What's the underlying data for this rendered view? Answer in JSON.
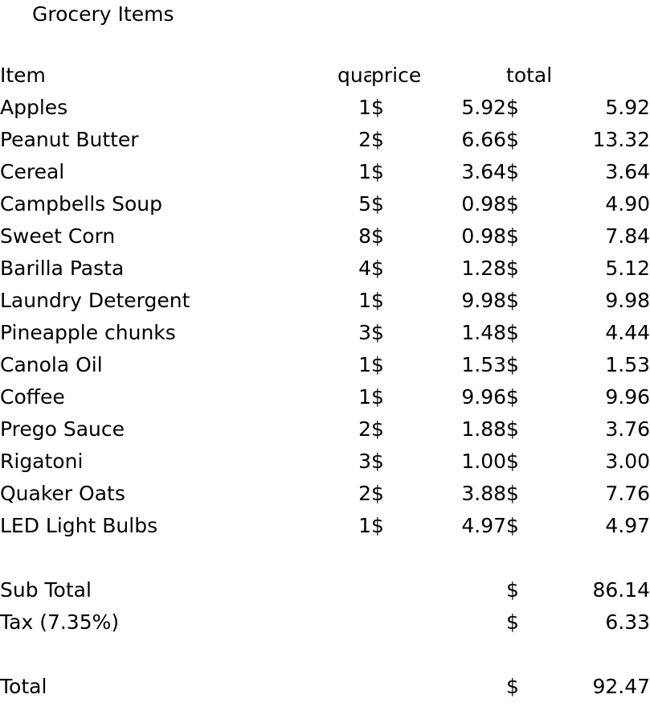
{
  "document": {
    "title": "Grocery Items"
  },
  "table": {
    "headers": {
      "item": "Item",
      "quantity": "quantity",
      "price": "price",
      "total": "total"
    },
    "currency_symbol": "$",
    "rows": [
      {
        "item": "Apples",
        "quantity": "1",
        "price": "5.92",
        "total": "5.92"
      },
      {
        "item": "Peanut Butter",
        "quantity": "2",
        "price": "6.66",
        "total": "13.32"
      },
      {
        "item": "Cereal",
        "quantity": "1",
        "price": "3.64",
        "total": "3.64"
      },
      {
        "item": "Campbells Soup",
        "quantity": "5",
        "price": "0.98",
        "total": "4.90"
      },
      {
        "item": "Sweet Corn",
        "quantity": "8",
        "price": "0.98",
        "total": "7.84"
      },
      {
        "item": "Barilla Pasta",
        "quantity": "4",
        "price": "1.28",
        "total": "5.12"
      },
      {
        "item": "Laundry Detergent",
        "quantity": "1",
        "price": "9.98",
        "total": "9.98"
      },
      {
        "item": "Pineapple chunks",
        "quantity": "3",
        "price": "1.48",
        "total": "4.44"
      },
      {
        "item": "Canola Oil",
        "quantity": "1",
        "price": "1.53",
        "total": "1.53"
      },
      {
        "item": "Coffee",
        "quantity": "1",
        "price": "9.96",
        "total": "9.96"
      },
      {
        "item": "Prego Sauce",
        "quantity": "2",
        "price": "1.88",
        "total": "3.76"
      },
      {
        "item": "Rigatoni",
        "quantity": "3",
        "price": "1.00",
        "total": "3.00"
      },
      {
        "item": "Quaker Oats",
        "quantity": "2",
        "price": "3.88",
        "total": "7.76"
      },
      {
        "item": "LED Light Bulbs",
        "quantity": "1",
        "price": "4.97",
        "total": "4.97"
      }
    ],
    "summary": [
      {
        "label": "Sub Total",
        "total": "86.14"
      },
      {
        "label": "Tax (7.35%)",
        "total": "6.33"
      }
    ],
    "grand_total": {
      "label": "Total",
      "total": "92.47"
    }
  },
  "colors": {
    "background": "#ffffff",
    "text": "#000000"
  }
}
